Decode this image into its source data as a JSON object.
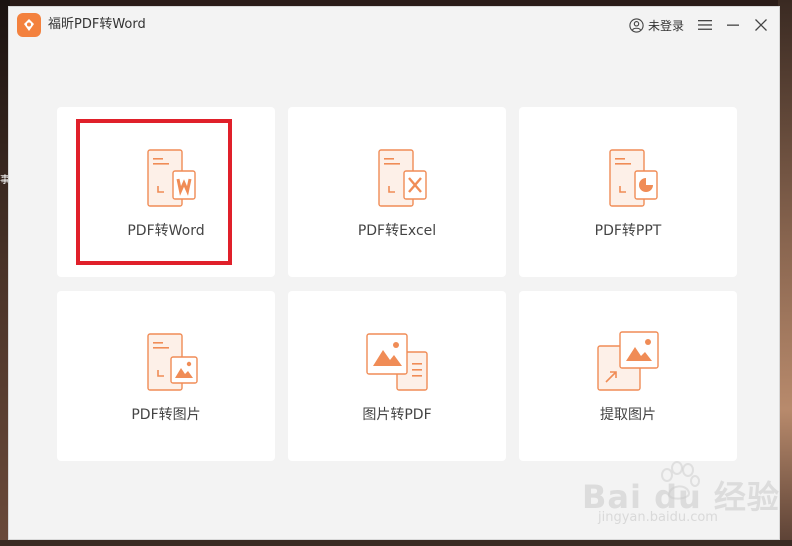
{
  "desktop": {
    "edge_glyph": "事"
  },
  "app": {
    "title": "福昕PDF转Word",
    "accent_color": "#f3813e",
    "icon_color": "#f08c56",
    "icon_fill": "#fdf0e8"
  },
  "titlebar": {
    "login_label": "未登录",
    "buttons": [
      {
        "name": "menu",
        "icon": "menu-icon"
      },
      {
        "name": "minimize",
        "icon": "minimize-icon"
      },
      {
        "name": "close",
        "icon": "close-icon"
      }
    ]
  },
  "tools": [
    {
      "id": "pdf-to-word",
      "label": "PDF转Word",
      "icon": "pdf-to-word-icon",
      "highlighted": true
    },
    {
      "id": "pdf-to-excel",
      "label": "PDF转Excel",
      "icon": "pdf-to-excel-icon",
      "highlighted": false
    },
    {
      "id": "pdf-to-ppt",
      "label": "PDF转PPT",
      "icon": "pdf-to-ppt-icon",
      "highlighted": false
    },
    {
      "id": "pdf-to-image",
      "label": "PDF转图片",
      "icon": "pdf-to-image-icon",
      "highlighted": false
    },
    {
      "id": "image-to-pdf",
      "label": "图片转PDF",
      "icon": "image-to-pdf-icon",
      "highlighted": false
    },
    {
      "id": "extract-image",
      "label": "提取图片",
      "icon": "extract-image-icon",
      "highlighted": false
    }
  ],
  "watermark": {
    "brand": "Bai du 经验",
    "url": "jingyan.baidu.com"
  }
}
